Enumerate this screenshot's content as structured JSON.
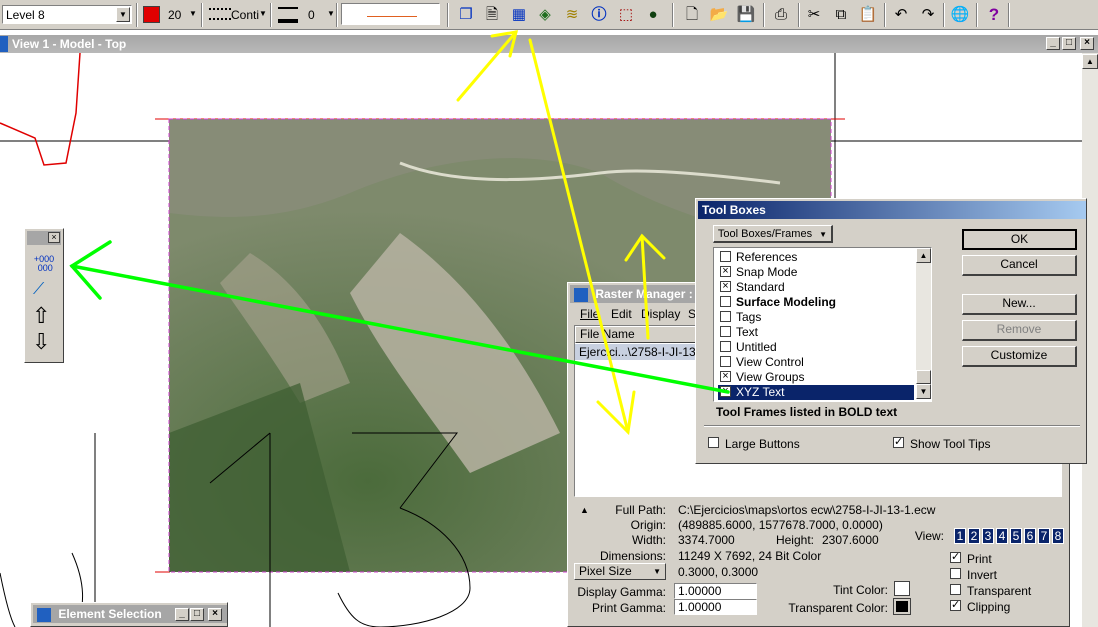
{
  "toolbar": {
    "level": "Level 8",
    "color_value": "20",
    "line_style": "Conti",
    "weight_value": "0"
  },
  "view": {
    "title": "View 1 - Model - Top"
  },
  "tool_boxes": {
    "title": "Tool Boxes",
    "dropdown": "Tool Boxes/Frames",
    "items": [
      {
        "label": "References",
        "checked": false,
        "bold": false
      },
      {
        "label": "Snap Mode",
        "checked": true,
        "bold": false
      },
      {
        "label": "Standard",
        "checked": true,
        "bold": false
      },
      {
        "label": "Surface Modeling",
        "checked": false,
        "bold": true
      },
      {
        "label": "Tags",
        "checked": false,
        "bold": false
      },
      {
        "label": "Text",
        "checked": false,
        "bold": false
      },
      {
        "label": "Untitled",
        "checked": false,
        "bold": false
      },
      {
        "label": "View Control",
        "checked": false,
        "bold": false
      },
      {
        "label": "View Groups",
        "checked": true,
        "bold": false
      },
      {
        "label": "XYZ Text",
        "checked": true,
        "bold": false,
        "selected": true
      }
    ],
    "note": "Tool Frames listed in BOLD text",
    "buttons": {
      "ok": "OK",
      "cancel": "Cancel",
      "new": "New...",
      "remove": "Remove",
      "customize": "Customize"
    },
    "large_buttons": "Large Buttons",
    "show_tool_tips": "Show Tool Tips",
    "large_buttons_checked": false,
    "show_tool_tips_checked": true
  },
  "raster_manager": {
    "title": "Raster Manager : ",
    "menu": [
      "File",
      "Edit",
      "Display",
      "S"
    ],
    "column_header": "File Name",
    "row": "Ejercici...\\2758-I-JI-13-1.",
    "full_path_label": "Full Path:",
    "full_path": "C:\\Ejercicios\\maps\\ortos ecw\\2758-I-JI-13-1.ecw",
    "origin_label": "Origin:",
    "origin": "(489885.6000, 1577678.7000, 0.0000)",
    "width_label": "Width:",
    "width": "3374.7000",
    "height_label": "Height:",
    "height": "2307.6000",
    "dimensions_label": "Dimensions:",
    "dimensions": "11249 X 7692, 24 Bit Color",
    "pixel_size_select": "Pixel Size",
    "pixel_size": "0.3000, 0.3000",
    "display_gamma_label": "Display Gamma:",
    "display_gamma": "1.00000",
    "print_gamma_label": "Print Gamma:",
    "print_gamma": "1.00000",
    "tint_color_label": "Tint Color:",
    "transparent_color_label": "Transparent Color:",
    "view_label": "View:",
    "view_numbers": [
      "1",
      "2",
      "3",
      "4",
      "5",
      "6",
      "7",
      "8"
    ],
    "options": [
      {
        "label": "Print",
        "checked": true
      },
      {
        "label": "Invert",
        "checked": false
      },
      {
        "label": "Transparent",
        "checked": false
      },
      {
        "label": "Clipping",
        "checked": true
      }
    ]
  },
  "xyz_toolbox": {
    "item_label": "+000\n000"
  },
  "element_selection": {
    "title": "Element Selection"
  },
  "colors": {
    "titlebar_active": "#0a246a",
    "titlebar_inactive": "#a6a6a6",
    "annotation_yellow": "#ffff00",
    "annotation_green": "#00ff00",
    "selection": "#0a246a"
  }
}
